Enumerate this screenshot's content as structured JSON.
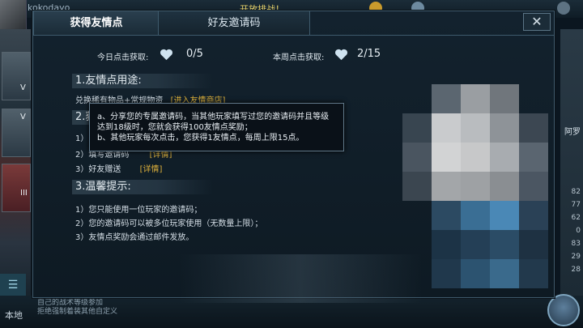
{
  "background": {
    "player_name": "kokodayo",
    "top_banner": "开放排战！",
    "location": "本地",
    "chat_lines": [
      "自己的战术等级参加",
      "拒绝强制着装其他自定义"
    ],
    "left_cards": [
      "V",
      "V",
      "III"
    ],
    "right_numbers": [
      "82",
      "77",
      "62",
      "0",
      "83",
      "29",
      "28"
    ],
    "right_label": "阿罗",
    "menu_icon": "list-icon"
  },
  "tabs": [
    {
      "label": "获得友情点",
      "active": true
    },
    {
      "label": "好友邀请码",
      "active": false
    }
  ],
  "close_label": "✕",
  "stats": {
    "today_label": "今日点击获取:",
    "today_value": "0/5",
    "week_label": "本周点击获取:",
    "week_value": "2/15",
    "icon": "heart-icon"
  },
  "sections": {
    "usage_title": "1.友情点用途:",
    "usage_text": "兑换稀有物品+常规物资",
    "usage_link": "[进入友情商店]",
    "obtain_title": "2.获",
    "obtain_items": [
      {
        "prefix": "1）",
        "text": "",
        "link": ""
      },
      {
        "prefix": "2）",
        "text": "填写邀请码",
        "link": "[详情]"
      },
      {
        "prefix": "3）",
        "text": "好友赠送",
        "link": "[详情]"
      }
    ],
    "tips_title": "3.温馨提示:",
    "tips": [
      "1）您只能使用一位玩家的邀请码；",
      "2）您的邀请码可以被多位玩家使用（无数量上限）；",
      "3）友情点奖励会通过邮件发放。"
    ]
  },
  "tooltip": {
    "lines": [
      "a、分享您的专属邀请码，当其他玩家填写过您的邀请码并且等级",
      "达到18级时，您就会获得100友情点奖励；",
      "b、其他玩家每次点击，您获得1友情点，每周上限15点。"
    ]
  },
  "colors": {
    "accent_link": "#e0b33c",
    "dialog_bg": "#13222e",
    "border": "#3f5a6c"
  }
}
